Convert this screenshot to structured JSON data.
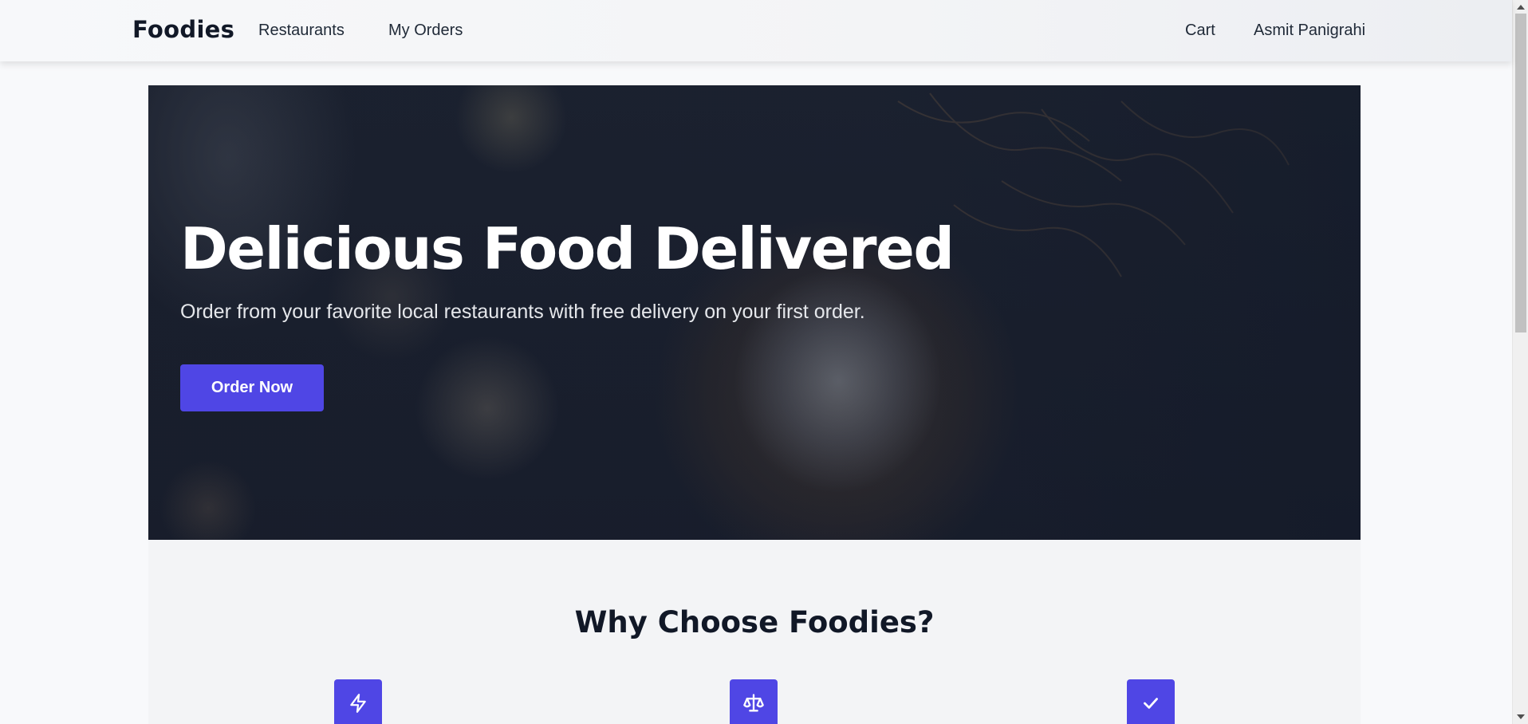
{
  "navbar": {
    "brand": "Foodies",
    "links": {
      "restaurants": "Restaurants",
      "my_orders": "My Orders",
      "cart": "Cart",
      "user": "Asmit Panigrahi"
    }
  },
  "hero": {
    "title": "Delicious Food Delivered",
    "subtitle": "Order from your favorite local restaurants with free delivery on your first order.",
    "cta_label": "Order Now"
  },
  "features": {
    "title": "Why Choose Foodies?",
    "icons": [
      "lightning-icon",
      "scale-icon",
      "check-icon"
    ]
  },
  "colors": {
    "accent": "#4f46e5",
    "hero_bg": "#1a2030",
    "section_bg": "#f3f4f6"
  }
}
